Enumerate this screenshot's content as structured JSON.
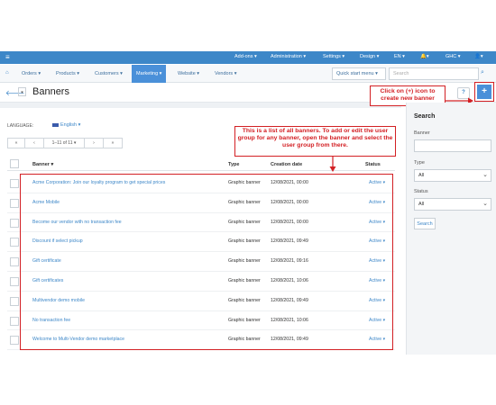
{
  "topbar": {
    "menus": [
      "Add-ons ▾",
      "Administration ▾",
      "Settings ▾",
      "Design ▾",
      "EN ▾",
      "GHC ▾"
    ]
  },
  "navbar": {
    "items": [
      "Orders ▾",
      "Products ▾",
      "Customers ▾",
      "Marketing ▾",
      "Website ▾",
      "Vendors ▾"
    ],
    "active": "Marketing ▾",
    "quick_start": "Quick start menu ▾",
    "search_placeholder": "Search"
  },
  "header": {
    "title": "Banners",
    "help": "?",
    "add": "+"
  },
  "language": {
    "label": "LANGUAGE:",
    "value": "English ▾"
  },
  "pager": {
    "first": "«",
    "prev": "‹",
    "range": "1–11 of 11 ▾",
    "next": "›",
    "last": "»"
  },
  "table": {
    "columns": [
      "Banner ▾",
      "Type",
      "Creation date",
      "Status"
    ],
    "rows": [
      {
        "name": "Acme Corporation: Join our loyalty program to get special prices",
        "type": "Graphic banner",
        "date": "12/08/2021, 00:00",
        "status": "Active ▾"
      },
      {
        "name": "Acme Mobile",
        "type": "Graphic banner",
        "date": "12/08/2021, 00:00",
        "status": "Active ▾"
      },
      {
        "name": "Become our vendor with no transaction fee",
        "type": "Graphic banner",
        "date": "12/08/2021, 00:00",
        "status": "Active ▾"
      },
      {
        "name": "Discount if select pickup",
        "type": "Graphic banner",
        "date": "12/08/2021, 09:49",
        "status": "Active ▾"
      },
      {
        "name": "Gift certificate",
        "type": "Graphic banner",
        "date": "12/08/2021, 09:16",
        "status": "Active ▾"
      },
      {
        "name": "Gift certificates",
        "type": "Graphic banner",
        "date": "12/08/2021, 10:06",
        "status": "Active ▾"
      },
      {
        "name": "Multivendor demo mobile",
        "type": "Graphic banner",
        "date": "12/08/2021, 09:49",
        "status": "Active ▾"
      },
      {
        "name": "No transaction fee",
        "type": "Graphic banner",
        "date": "12/08/2021, 10:06",
        "status": "Active ▾"
      },
      {
        "name": "Welcome to Multi-Vendor demo marketplace",
        "type": "Graphic banner",
        "date": "12/08/2021, 09:49",
        "status": "Active ▾"
      }
    ]
  },
  "sidebar": {
    "title": "Search",
    "banner_label": "Banner",
    "type_label": "Type",
    "type_value": "All",
    "status_label": "Status",
    "status_value": "All",
    "search_button": "Search"
  },
  "annotations": {
    "add_callout": "Click on (+) icon to create new banner",
    "list_callout": "This is a list of all banners. To add or edit the user group for any banner, open the banner and select the user group from there."
  },
  "colors": {
    "accent": "#3d87c8",
    "annotation_red": "#d32024"
  }
}
